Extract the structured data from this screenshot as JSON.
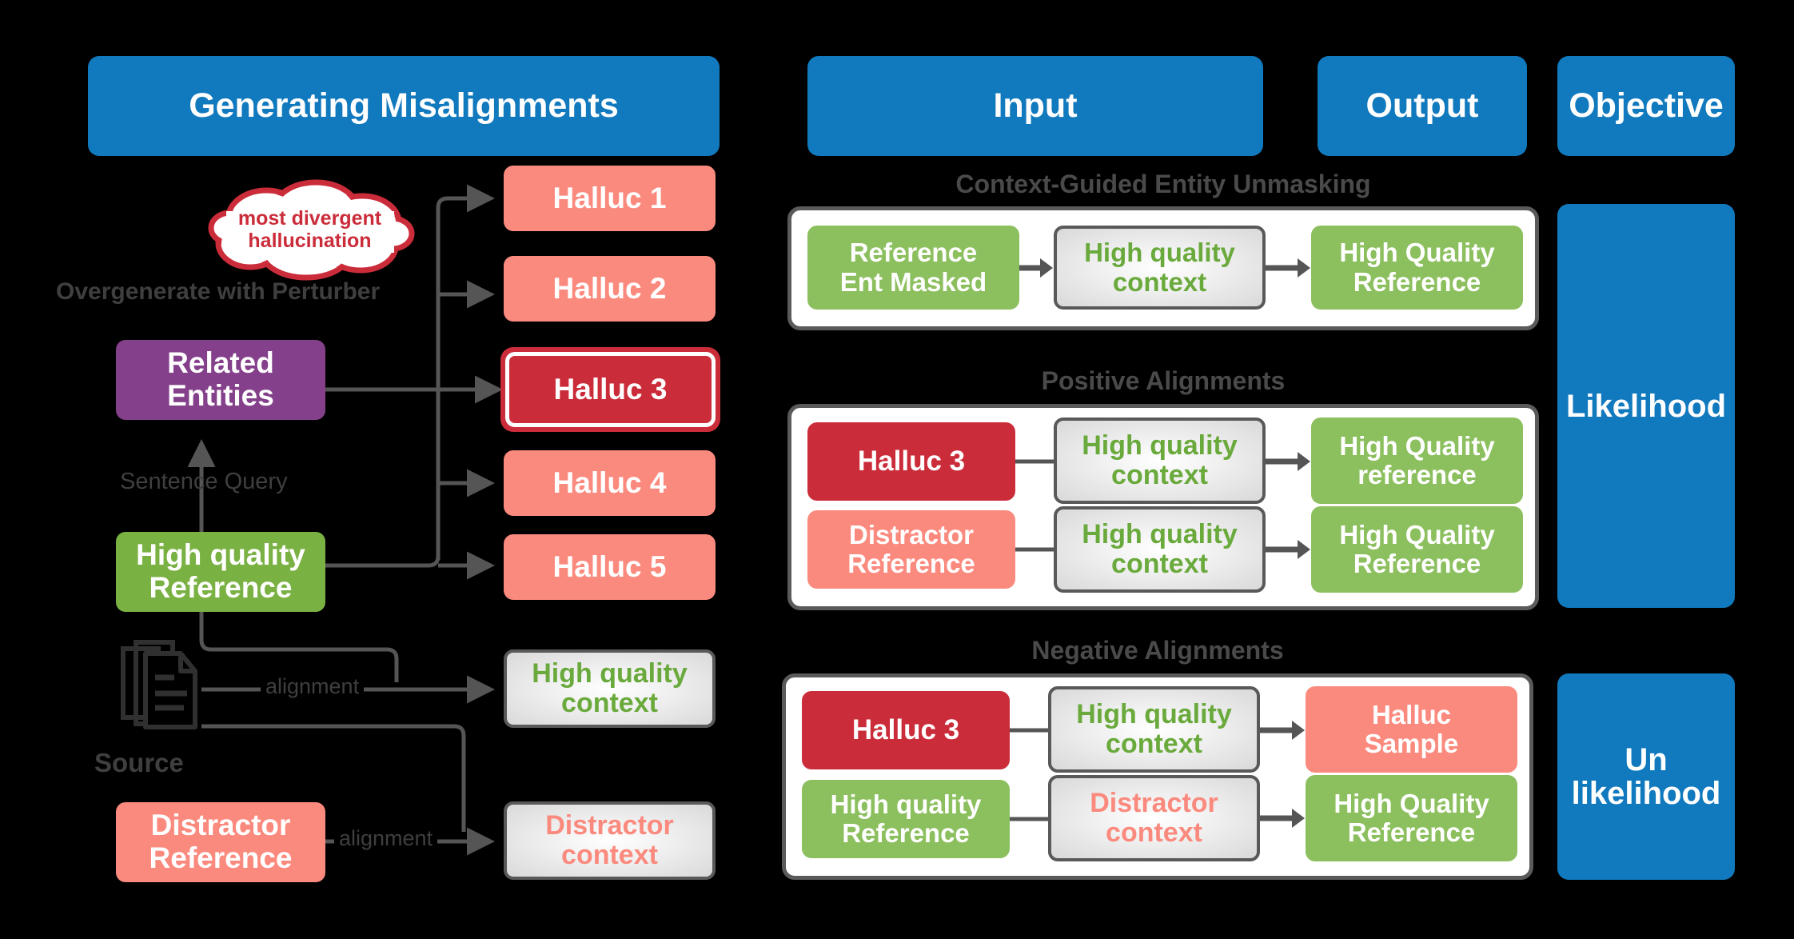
{
  "headers": {
    "generating": "Generating Misalignments",
    "input": "Input",
    "output": "Output",
    "objective": "Objective"
  },
  "left": {
    "cloud": {
      "line1": "most divergent",
      "line2": "hallucination"
    },
    "labels": {
      "overgenerate": "Overgenerate with Perturber",
      "sentence_query": "Sentence Query",
      "source": "Source",
      "alignment_top": "alignment",
      "alignment_bottom": "alignment"
    },
    "nodes": {
      "related_entities": {
        "line1": "Related",
        "line2": "Entities"
      },
      "high_quality_reference": {
        "line1": "High quality",
        "line2": "Reference"
      },
      "distractor_reference": {
        "line1": "Distractor",
        "line2": "Reference"
      },
      "high_quality_context": {
        "line1": "High quality",
        "line2": "context"
      },
      "distractor_context": {
        "line1": "Distractor",
        "line2": "context"
      }
    },
    "halluc": [
      {
        "label": "Halluc 1",
        "highlighted": false
      },
      {
        "label": "Halluc 2",
        "highlighted": false
      },
      {
        "label": "Halluc 3",
        "highlighted": true
      },
      {
        "label": "Halluc 4",
        "highlighted": false
      },
      {
        "label": "Halluc 5",
        "highlighted": false
      }
    ],
    "source_icon": "documents-stack-icon"
  },
  "right": {
    "sections": [
      {
        "title": "Context-Guided Entity Unmasking",
        "rows": [
          {
            "input": {
              "line1": "Reference",
              "line2": "Ent Masked"
            },
            "ctx": {
              "line1": "High quality",
              "line2": "context"
            },
            "output": {
              "line1": "High Quality",
              "line2": "Reference"
            }
          }
        ]
      },
      {
        "title": "Positive Alignments",
        "rows": [
          {
            "input": {
              "line1": "Halluc 3",
              "line2": ""
            },
            "ctx": {
              "line1": "High quality",
              "line2": "context"
            },
            "output": {
              "line1": "High Quality",
              "line2": "reference"
            }
          },
          {
            "input": {
              "line1": "Distractor",
              "line2": "Reference"
            },
            "ctx": {
              "line1": "High quality",
              "line2": "context"
            },
            "output": {
              "line1": "High Quality",
              "line2": "Reference"
            }
          }
        ]
      },
      {
        "title": "Negative Alignments",
        "rows": [
          {
            "input": {
              "line1": "Halluc 3",
              "line2": ""
            },
            "ctx": {
              "line1": "High quality",
              "line2": "context"
            },
            "output": {
              "line1": "Halluc",
              "line2": "Sample"
            }
          },
          {
            "input": {
              "line1": "High quality",
              "line2": "Reference"
            },
            "ctx": {
              "line1": "Distractor",
              "line2": "context"
            },
            "output": {
              "line1": "High Quality",
              "line2": "Reference"
            }
          }
        ]
      }
    ],
    "objectives": [
      {
        "line1": "Likelihood",
        "line2": ""
      },
      {
        "line1": "Un",
        "line2": "likelihood"
      }
    ]
  },
  "colors": {
    "blue": "#1179bd",
    "green": "#7ab143",
    "green_light": "#8cbf5e",
    "salmon": "#fb8a7e",
    "dark_red": "#cb2c3a",
    "purple": "#84408a",
    "grey_border": "#5a5a5a",
    "caption_grey": "#3f3f3f"
  }
}
